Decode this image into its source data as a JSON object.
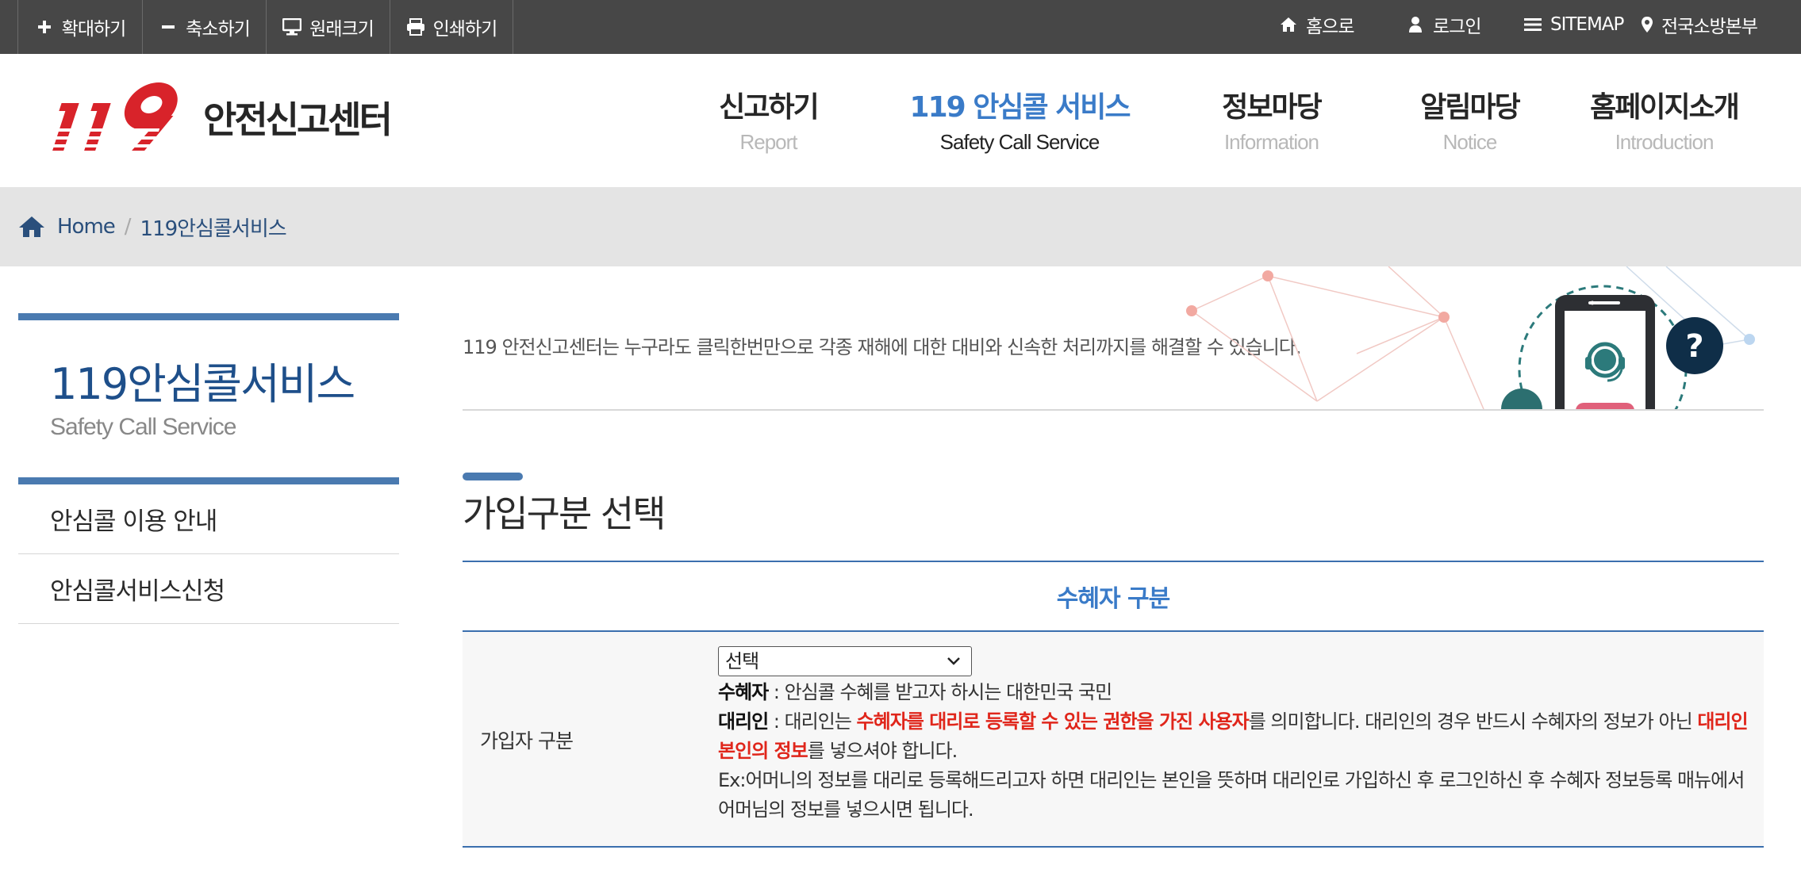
{
  "topbar": {
    "zoom_in": "확대하기",
    "zoom_out": "축소하기",
    "original_size": "원래크기",
    "print": "인쇄하기",
    "home": "홈으로",
    "login": "로그인",
    "sitemap": "SITEMAP",
    "hq": "전국소방본부"
  },
  "logo": {
    "mark": "119",
    "text": "안전신고센터"
  },
  "nav": [
    {
      "ko": "신고하기",
      "en": "Report",
      "active": false
    },
    {
      "ko": "119 안심콜 서비스",
      "en": "Safety Call Service",
      "active": true
    },
    {
      "ko": "정보마당",
      "en": "Information",
      "active": false
    },
    {
      "ko": "알림마당",
      "en": "Notice",
      "active": false
    },
    {
      "ko": "홈페이지소개",
      "en": "Introduction",
      "active": false
    }
  ],
  "breadcrumb": {
    "home": "Home",
    "current": "119안심콜서비스"
  },
  "sidebar": {
    "title": "119안심콜서비스",
    "subtitle": "Safety Call Service",
    "items": [
      {
        "label": "안심콜 이용 안내"
      },
      {
        "label": "안심콜서비스신청"
      }
    ]
  },
  "intro": {
    "text": "119 안전신고센터는 누구라도 클릭한번만으로 각종 재해에 대한 대비와 신속한 처리까지를 해결할 수 있습니다."
  },
  "section": {
    "title": "가입구분 선택"
  },
  "table": {
    "header": "수혜자 구분",
    "row_label": "가입자 구분",
    "select_value": "선택",
    "line1_bold": "수혜자",
    "line1_text": " : 안심콜 수혜를 받고자 하시는 대한민국 국민",
    "line2_bold": "대리인",
    "line2_text1": " : 대리인는 ",
    "line2_red": "수혜자를 대리로 등록할 수 있는 권한을 가진 사용자",
    "line2_text2": "를 의미합니다. 대리인의 경우 반드시 수혜자의 정보가 아닌 ",
    "line2_red2": "대리인 본인의 정보",
    "line2_text3": "를 넣으셔야 합니다.",
    "line3": "Ex:어머니의 정보를 대리로 등록해드리고자 하면 대리인는 본인을 뜻하며 대리인로 가입하신 후 로그인하신 후 수혜자 정보등록 매뉴에서 어머님의 정보를 넣으시면 됩니다."
  },
  "colors": {
    "topbar": "#474747",
    "accent": "#3a7bc8",
    "brand_red": "#e0261b",
    "sidebar_bar": "#4a7ab0",
    "dark_blue": "#1e4f8a"
  }
}
